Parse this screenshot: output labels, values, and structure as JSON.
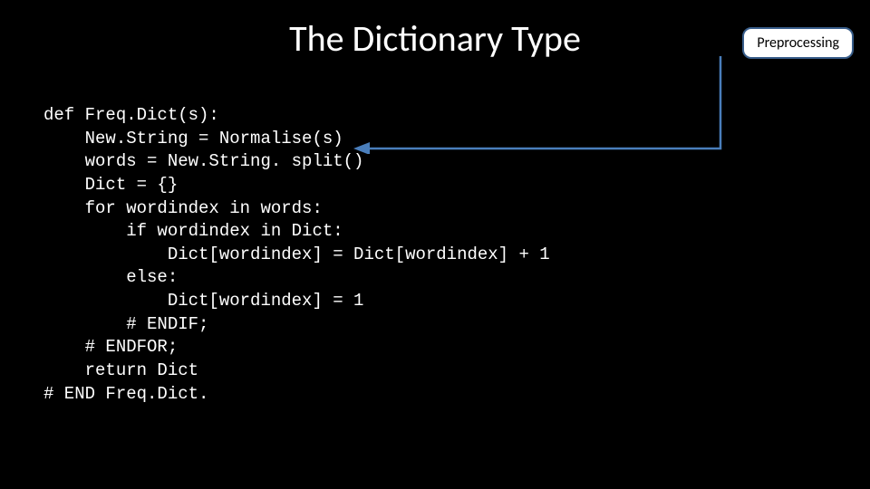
{
  "slide": {
    "title": "The Dictionary Type",
    "badge": "Preprocessing",
    "code": "def Freq.Dict(s):\n    New.String = Normalise(s)\n    words = New.String. split()\n    Dict = {}\n    for wordindex in words:\n        if wordindex in Dict:\n            Dict[wordindex] = Dict[wordindex] + 1\n        else:\n            Dict[wordindex] = 1\n        # ENDIF;\n    # ENDFOR;\n    return Dict\n# END Freq.Dict."
  }
}
